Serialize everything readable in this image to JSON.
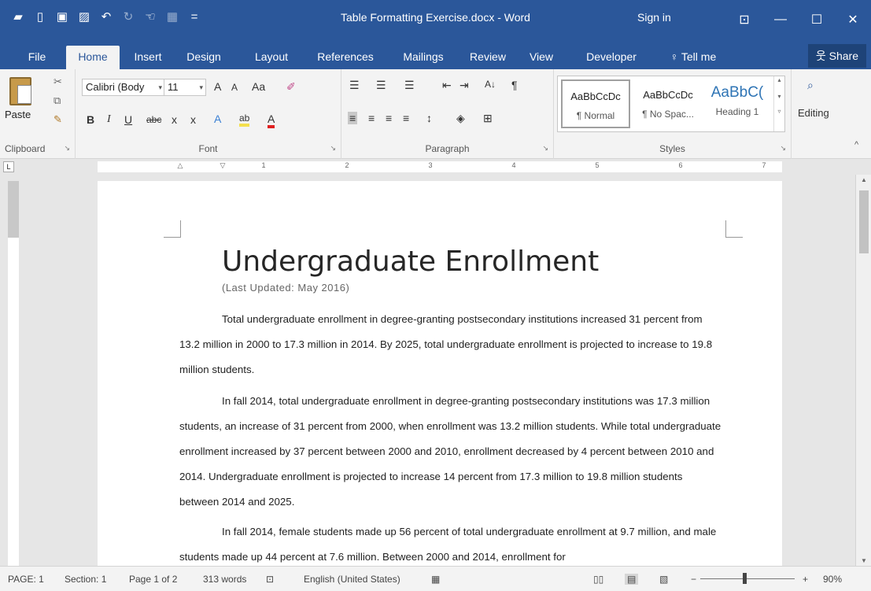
{
  "window": {
    "title": "Table Formatting Exercise.docx - Word",
    "sign_in": "Sign in",
    "ribbon_display_icon": "ribbon-display-options-icon",
    "minimize_icon": "minimize-icon",
    "maximize_icon": "maximize-icon",
    "close_icon": "close-icon"
  },
  "qat": {
    "icons": [
      "open-icon",
      "new-icon",
      "save-icon",
      "save-as-icon",
      "undo-icon",
      "redo-icon",
      "touch-mode-icon",
      "table-icon",
      "customize-icon"
    ]
  },
  "tabs": [
    {
      "label": "File",
      "active": false
    },
    {
      "label": "Home",
      "active": true
    },
    {
      "label": "Insert",
      "active": false
    },
    {
      "label": "Design",
      "active": false
    },
    {
      "label": "Layout",
      "active": false
    },
    {
      "label": "References",
      "active": false
    },
    {
      "label": "Mailings",
      "active": false
    },
    {
      "label": "Review",
      "active": false
    },
    {
      "label": "View",
      "active": false
    },
    {
      "label": "Developer",
      "active": false
    }
  ],
  "tell_me": "Tell me",
  "share": "Share",
  "ribbon": {
    "clipboard": {
      "label": "Clipboard",
      "paste": "Paste"
    },
    "font": {
      "label": "Font",
      "font_name": "Calibri (Body",
      "font_size": "11",
      "grow": "A",
      "shrink": "A",
      "change_case": "Aa",
      "bold": "B",
      "italic": "I",
      "underline": "U",
      "strike": "abc",
      "sub": "x",
      "sup": "x",
      "effects": "A",
      "highlight": "ab",
      "color": "A"
    },
    "paragraph": {
      "label": "Paragraph",
      "sort": "A↓",
      "pilcrow": "¶"
    },
    "styles": {
      "label": "Styles",
      "items": [
        {
          "sample": "AaBbCcDc",
          "name": "¶ Normal"
        },
        {
          "sample": "AaBbCcDc",
          "name": "¶ No Spac..."
        },
        {
          "sample": "AaBbC(",
          "name": "Heading 1"
        }
      ]
    },
    "editing": {
      "label": "Editing"
    }
  },
  "ruler_numbers": [
    "1",
    "2",
    "3",
    "4",
    "5",
    "6",
    "7"
  ],
  "document": {
    "title": "Undergraduate Enrollment",
    "subtitle": "(Last Updated: May 2016)",
    "paragraphs": [
      "Total undergraduate enrollment in degree-granting postsecondary institutions increased 31 percent from 13.2 million in 2000 to 17.3 million in 2014. By 2025, total undergraduate enrollment is projected to increase to 19.8 million students.",
      "In fall 2014, total undergraduate enrollment in degree-granting postsecondary institutions was 17.3 million students, an increase of 31 percent from 2000, when enrollment was 13.2 million students. While total undergraduate enrollment increased by 37 percent between 2000 and 2010, enrollment decreased by 4 percent between 2010 and 2014. Undergraduate enrollment is projected to increase 14 percent from 17.3 million to 19.8 million students between 2014 and 2025.",
      "In fall 2014, female students made up 56 percent of total undergraduate enrollment at 9.7 million, and male students made up 44 percent at 7.6 million. Between 2000 and 2014, enrollment for"
    ]
  },
  "status": {
    "page": "PAGE: 1",
    "section": "Section: 1",
    "page_of": "Page 1 of 2",
    "words": "313 words",
    "language": "English (United States)",
    "zoom": "90%",
    "zoom_level": 0.9
  }
}
